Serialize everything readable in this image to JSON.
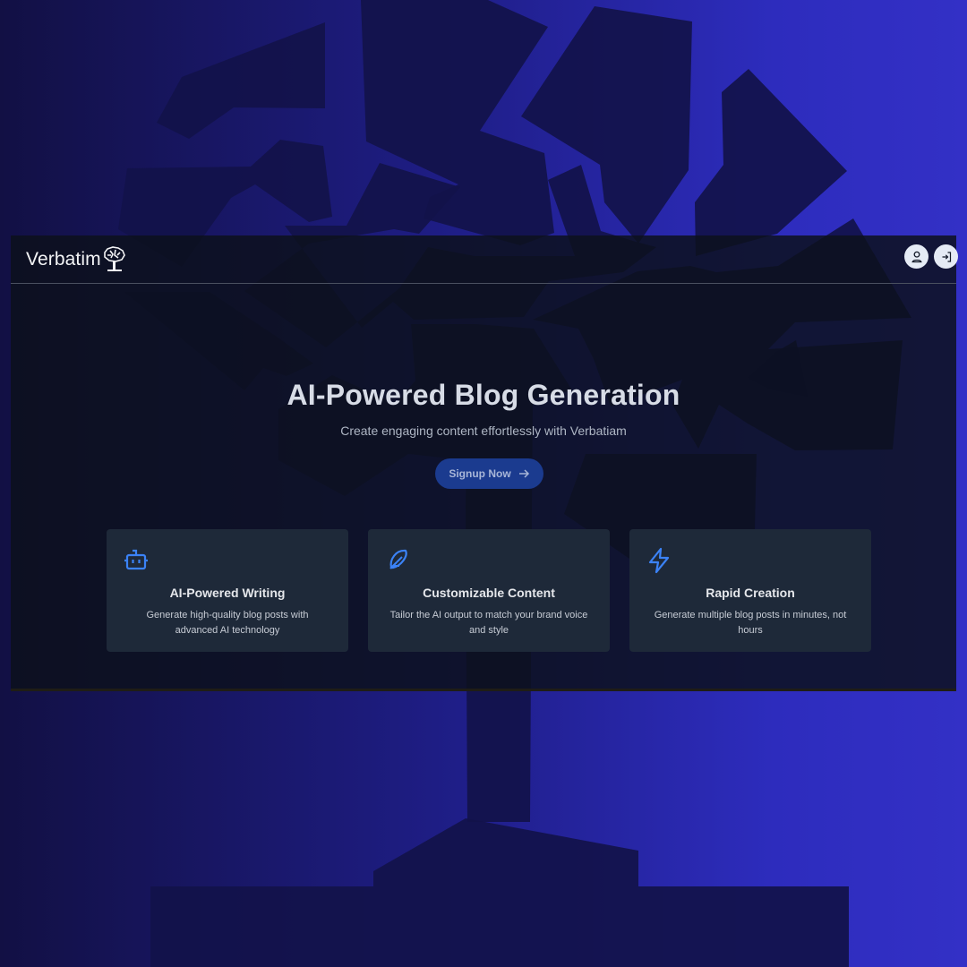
{
  "header": {
    "brand_name": "Verbatim",
    "logo_icon": "tree-logo-icon",
    "actions": [
      {
        "icon": "user-icon"
      },
      {
        "icon": "sign-in-icon"
      }
    ]
  },
  "hero": {
    "title": "AI-Powered Blog Generation",
    "subtitle": "Create engaging content effortlessly with Verbatiam",
    "cta_label": "Signup Now",
    "cta_icon": "arrow-right-icon"
  },
  "features": [
    {
      "icon": "robot-icon",
      "title": "AI-Powered Writing",
      "description": "Generate high-quality blog posts with advanced AI technology"
    },
    {
      "icon": "feather-icon",
      "title": "Customizable Content",
      "description": "Tailor the AI output to match your brand voice and style"
    },
    {
      "icon": "lightning-icon",
      "title": "Rapid Creation",
      "description": "Generate multiple blog posts in minutes, not hours"
    }
  ],
  "colors": {
    "background_left": "#121044",
    "background_right": "#3330c6",
    "panel": "#0c111c",
    "accent": "#3b82f6",
    "cta_background": "#1b3b8f"
  }
}
